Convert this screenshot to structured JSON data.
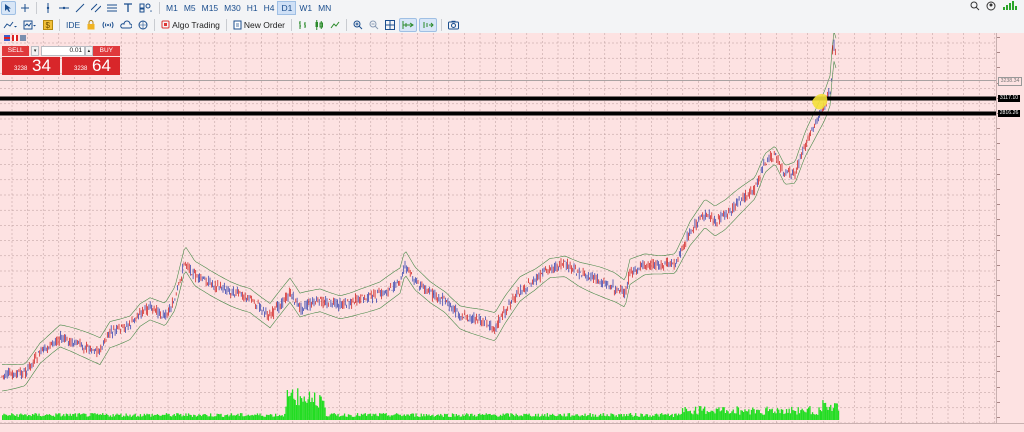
{
  "toolbar1": {
    "timeframes": [
      "M1",
      "M5",
      "M15",
      "M30",
      "H1",
      "H4",
      "D1",
      "W1",
      "MN"
    ],
    "active_timeframe": "D1",
    "icons": [
      "cursor-icon",
      "crosshair-icon",
      "vertical-line-icon",
      "horizontal-line-icon",
      "trendline-icon",
      "channel-icon",
      "fibonacci-icon",
      "text-icon",
      "shapes-icon"
    ]
  },
  "toolbar2": {
    "ide_label": "IDE",
    "algo_trading_label": "Algo Trading",
    "new_order_label": "New Order"
  },
  "trade_panel": {
    "sell_label": "SELL",
    "buy_label": "BUY",
    "lot": "0.01",
    "bid_small": "3238",
    "bid_big": "34",
    "ask_small": "3238",
    "ask_big": "64"
  },
  "price_levels": [
    {
      "label": "3238.34",
      "style": "bid"
    },
    {
      "label": "3117.10",
      "style": "level"
    },
    {
      "label": "2816.26",
      "style": "level"
    }
  ],
  "colors": {
    "background": "#fde2e2",
    "grid": "#b99a9a",
    "bull": "#2233aa",
    "bear": "#cc1111",
    "envelope": "#4a8a4a",
    "volume": "#22dd22",
    "level_line": "#000000"
  }
}
